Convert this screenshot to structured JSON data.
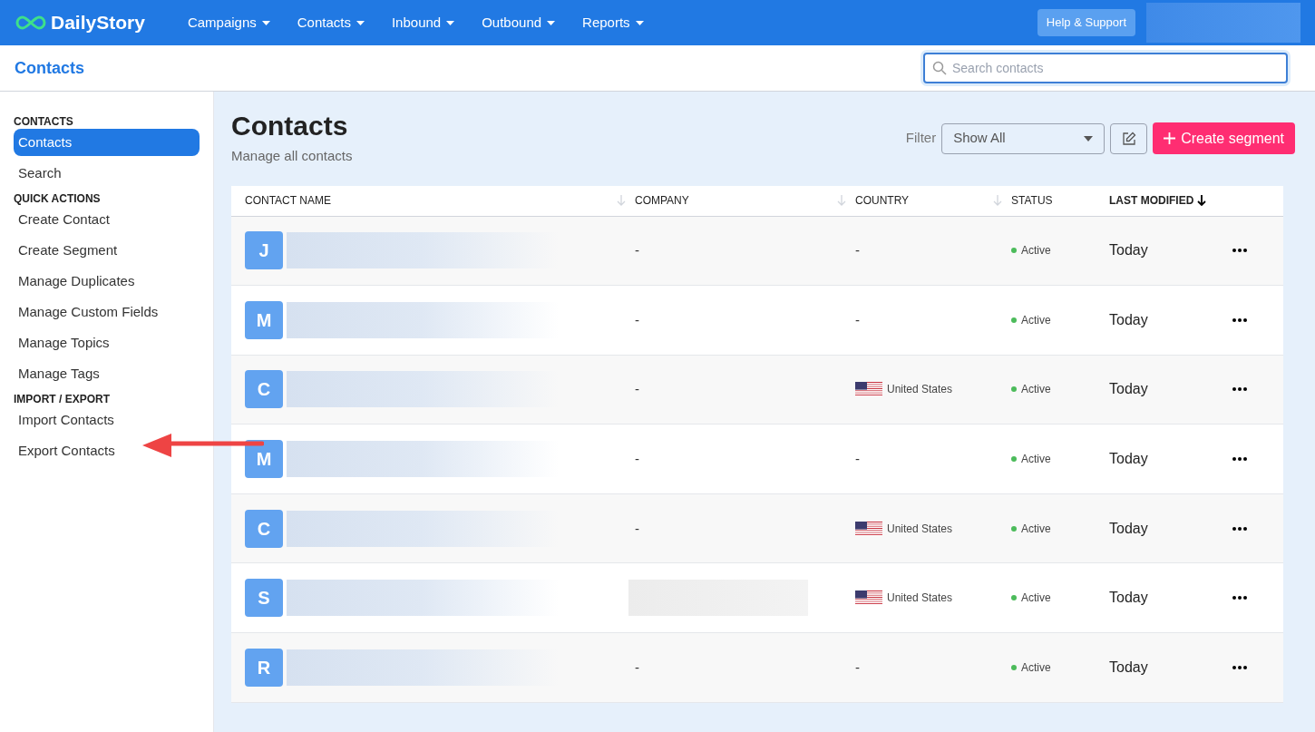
{
  "topnav": {
    "brand": "DailyStory",
    "menus": [
      {
        "label": "Campaigns"
      },
      {
        "label": "Contacts"
      },
      {
        "label": "Inbound"
      },
      {
        "label": "Outbound"
      },
      {
        "label": "Reports"
      }
    ],
    "help": "Help & Support"
  },
  "header": {
    "title": "Contacts",
    "search": {
      "placeholder": "Search contacts"
    }
  },
  "sidebar": {
    "sections": [
      {
        "heading": "CONTACTS",
        "items": [
          {
            "label": "Contacts",
            "selected": true
          },
          {
            "label": "Search",
            "selected": false
          }
        ]
      },
      {
        "heading": "QUICK ACTIONS",
        "items": [
          {
            "label": "Create Contact",
            "selected": false
          },
          {
            "label": "Create Segment",
            "selected": false
          },
          {
            "label": "Manage Duplicates",
            "selected": false
          },
          {
            "label": "Manage Custom Fields",
            "selected": false
          },
          {
            "label": "Manage Topics",
            "selected": false
          },
          {
            "label": "Manage Tags",
            "selected": false
          }
        ]
      },
      {
        "heading": "IMPORT / EXPORT",
        "items": [
          {
            "label": "Import Contacts",
            "selected": false
          },
          {
            "label": "Export Contacts",
            "selected": false,
            "annotated": true
          }
        ]
      }
    ]
  },
  "page": {
    "title": "Contacts",
    "subtitle": "Manage all contacts",
    "filter_label": "Filter",
    "filter_value": "Show All",
    "create_button": "Create segment"
  },
  "table": {
    "columns": [
      {
        "label": "CONTACT NAME",
        "sorted": false
      },
      {
        "label": "COMPANY",
        "sorted": false
      },
      {
        "label": "COUNTRY",
        "sorted": false
      },
      {
        "label": "STATUS"
      },
      {
        "label": "LAST MODIFIED",
        "sorted": true
      }
    ],
    "rows": [
      {
        "initial": "J",
        "company": "-",
        "country": "-",
        "flag": false,
        "status": "Active",
        "modified": "Today"
      },
      {
        "initial": "M",
        "company": "-",
        "country": "-",
        "flag": false,
        "status": "Active",
        "modified": "Today"
      },
      {
        "initial": "C",
        "company": "-",
        "country": "United States",
        "flag": true,
        "status": "Active",
        "modified": "Today"
      },
      {
        "initial": "M",
        "company": "-",
        "country": "-",
        "flag": false,
        "status": "Active",
        "modified": "Today"
      },
      {
        "initial": "C",
        "company": "-",
        "country": "United States",
        "flag": true,
        "status": "Active",
        "modified": "Today"
      },
      {
        "initial": "S",
        "company_redacted": true,
        "country": "United States",
        "flag": true,
        "status": "Active",
        "modified": "Today"
      },
      {
        "initial": "R",
        "company": "-",
        "country": "-",
        "flag": false,
        "status": "Active",
        "modified": "Today"
      }
    ]
  }
}
